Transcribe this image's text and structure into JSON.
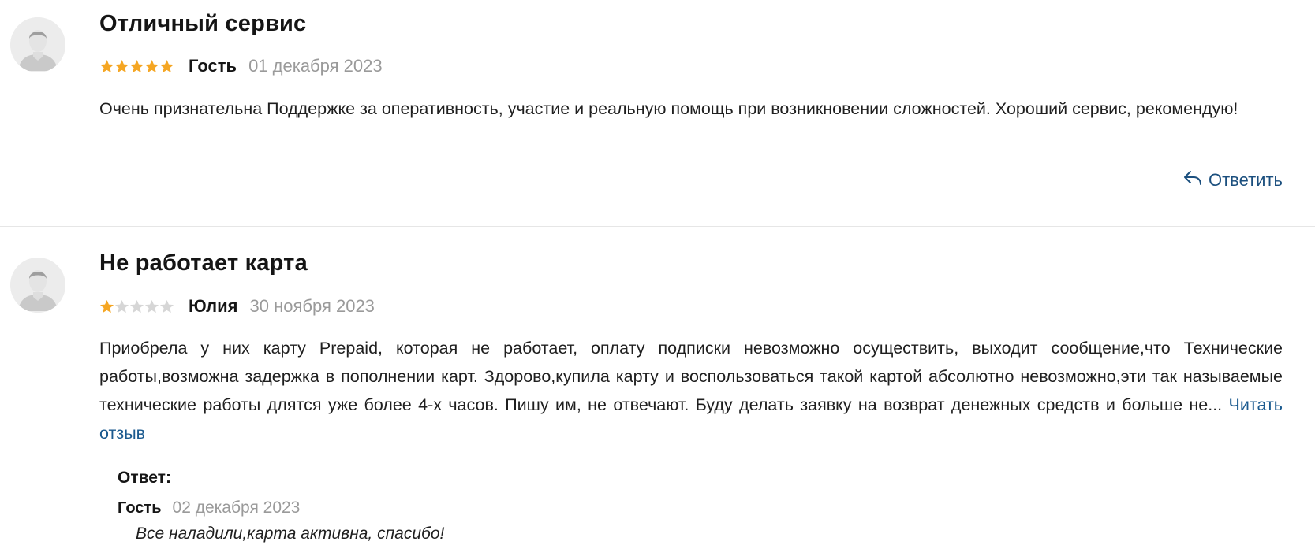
{
  "colors": {
    "star_filled": "#f5a623",
    "star_empty": "#d6d6d6",
    "link": "#1b5a8f",
    "date": "#9a9a9a"
  },
  "reviews": [
    {
      "title": "Отличный сервис",
      "rating": 5,
      "max_rating": 5,
      "author": "Гость",
      "date": "01 декабря 2023",
      "text": "Очень признательна Поддержке за оперативность, участие и реальную помощь при возникновении сложностей. Хороший сервис, рекомендую!",
      "reply_label": "Ответить",
      "avatar_icon": "user-avatar-icon",
      "reply_icon": "reply-arrow-icon"
    },
    {
      "title": "Не работает карта",
      "rating": 1,
      "max_rating": 5,
      "author": "Юлия",
      "date": "30 ноября 2023",
      "text": "Приобрела у них карту Prepaid, которая не работает, оплату подписки невозможно осуществить, выходит сообщение,что Технические работы,возможна задержка в пополнении карт. Здорово,купила карту и воспользоваться такой картой абсолютно невозможно,эти так называемые технические работы длятся уже более 4-х часов. Пишу им, не отвечают. Буду делать заявку на возврат денежных средств и больше не...",
      "read_more": "Читать отзыв",
      "avatar_icon": "user-avatar-icon",
      "answer": {
        "label": "Ответ:",
        "author": "Гость",
        "date": "02 декабря 2023",
        "text": "Все наладили,карта активна, спасибо!"
      }
    }
  ]
}
